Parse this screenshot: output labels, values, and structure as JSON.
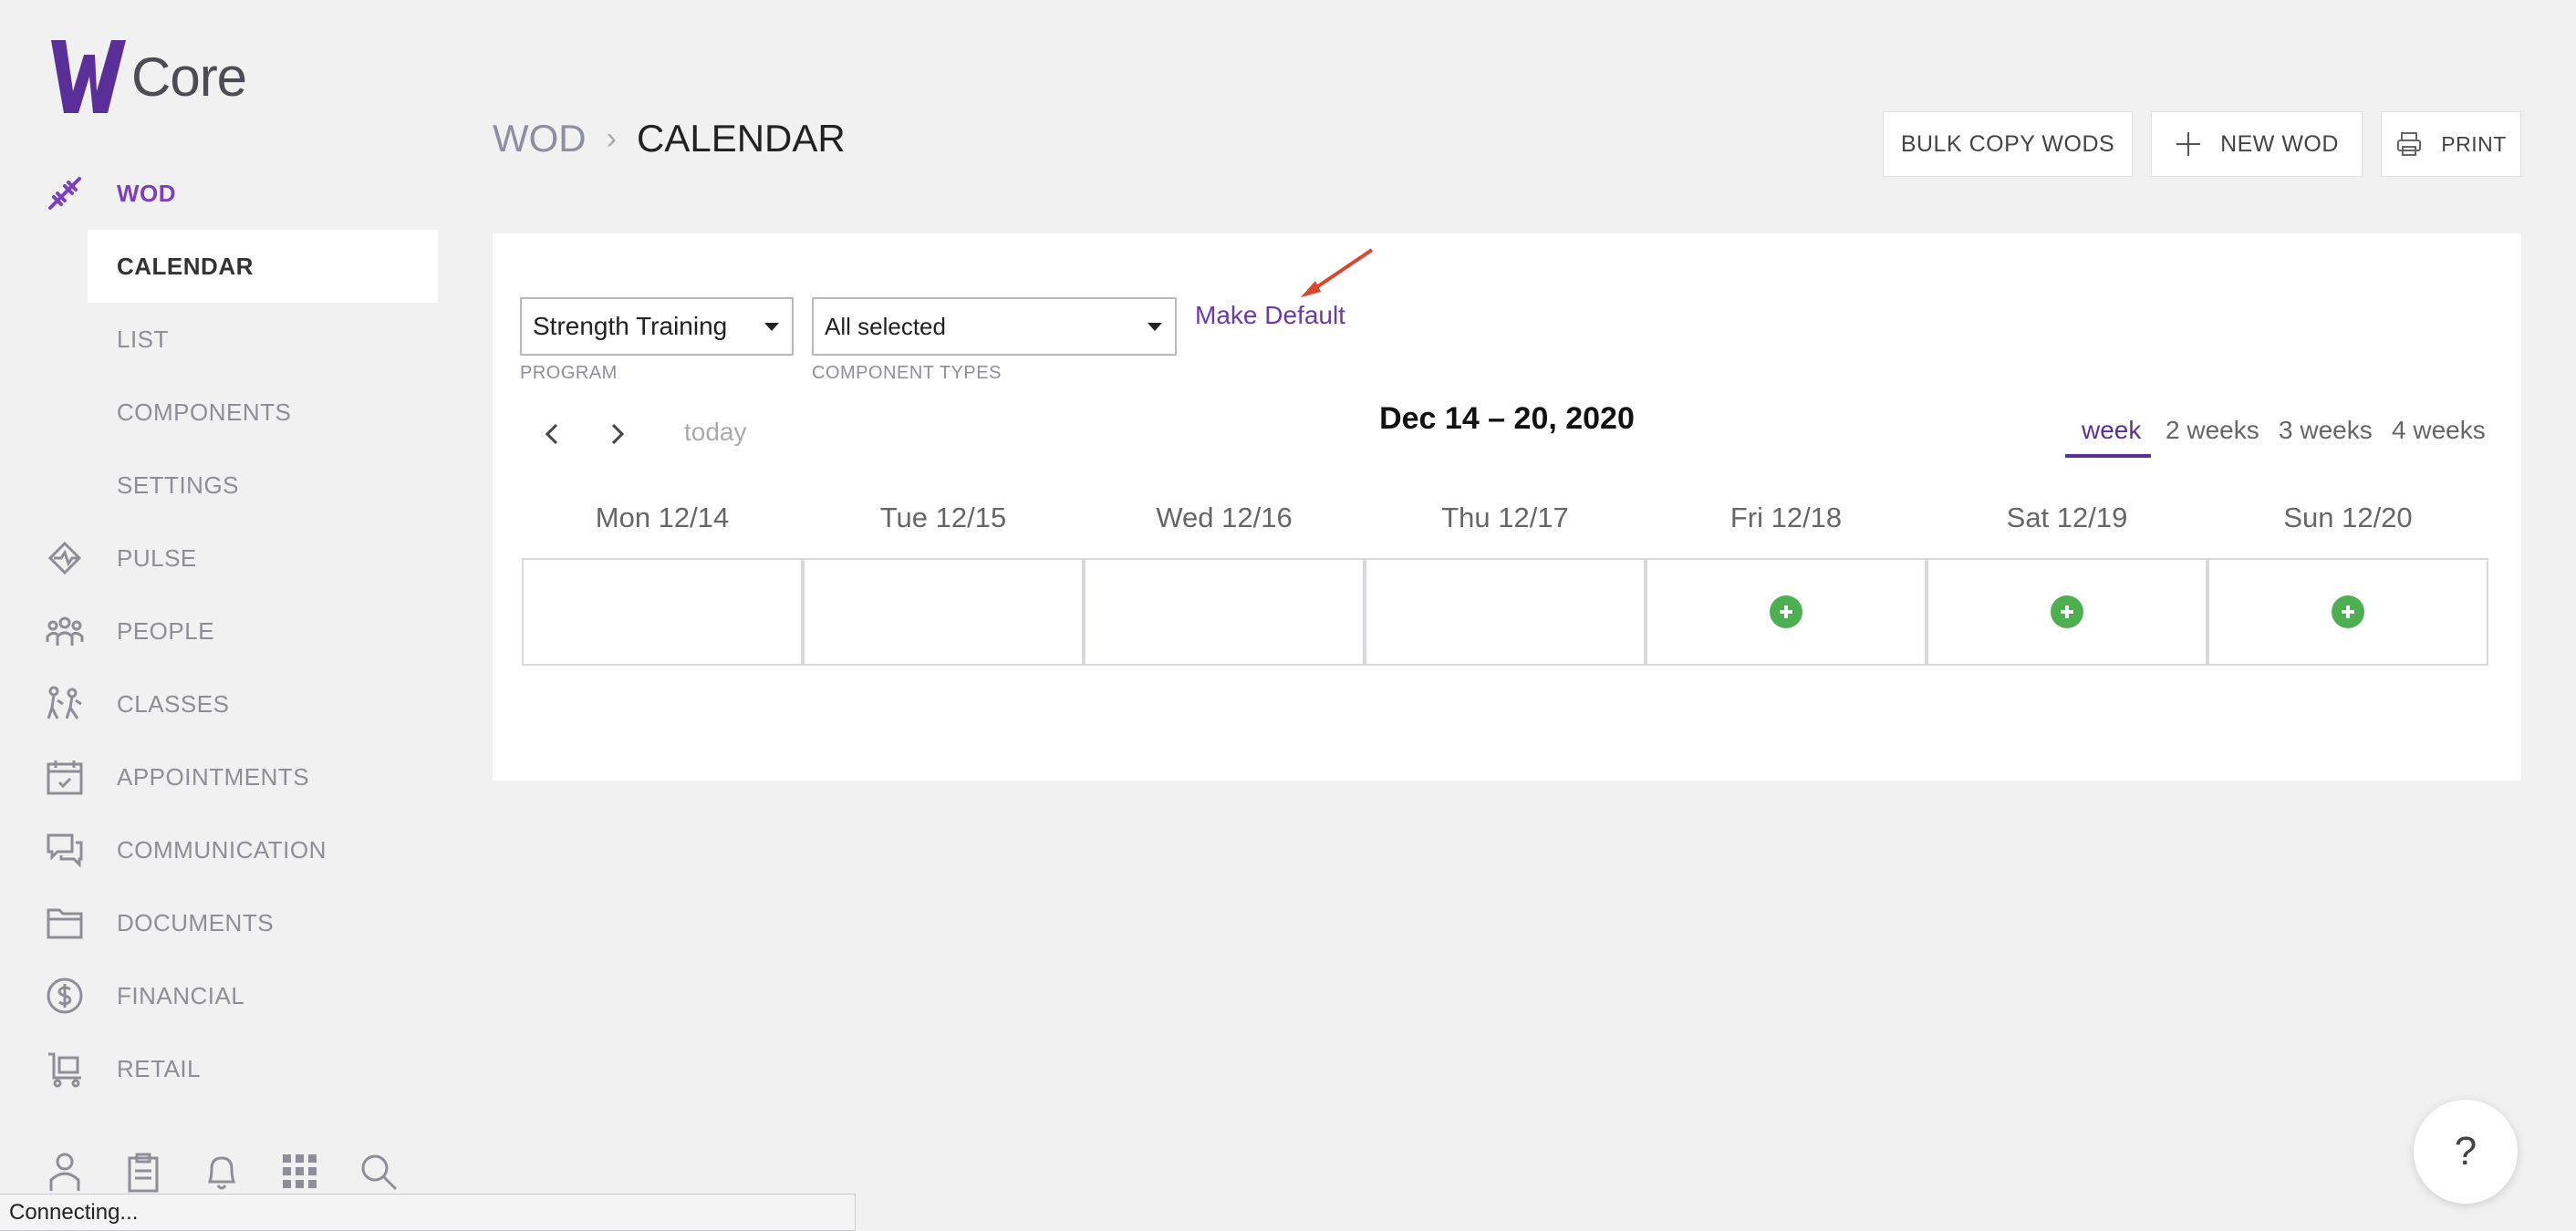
{
  "app": {
    "logo_text": "Core"
  },
  "sidebar": {
    "items": [
      {
        "label": "WOD",
        "icon": "dumbbell-icon"
      },
      {
        "label": "PULSE",
        "icon": "pulse-icon"
      },
      {
        "label": "PEOPLE",
        "icon": "people-icon"
      },
      {
        "label": "CLASSES",
        "icon": "classes-icon"
      },
      {
        "label": "APPOINTMENTS",
        "icon": "calendar-icon"
      },
      {
        "label": "COMMUNICATION",
        "icon": "chat-icon"
      },
      {
        "label": "DOCUMENTS",
        "icon": "folder-icon"
      },
      {
        "label": "FINANCIAL",
        "icon": "dollar-icon"
      },
      {
        "label": "RETAIL",
        "icon": "cart-icon"
      }
    ],
    "sub_items": [
      {
        "label": "CALENDAR"
      },
      {
        "label": "LIST"
      },
      {
        "label": "COMPONENTS"
      },
      {
        "label": "SETTINGS"
      }
    ],
    "bottom_icons": [
      "user-icon",
      "clipboard-icon",
      "bell-icon",
      "grid-icon",
      "search-icon"
    ]
  },
  "header": {
    "breadcrumb_root": "WOD",
    "breadcrumb_sep": "›",
    "breadcrumb_current": "CALENDAR",
    "bulk_copy_label": "BULK COPY WODS",
    "new_wod_label": "NEW WOD",
    "print_label": "PRINT"
  },
  "filters": {
    "program_value": "Strength Training",
    "program_label": "PROGRAM",
    "component_value": "All selected",
    "component_label": "COMPONENT TYPES",
    "make_default": "Make Default"
  },
  "calendar": {
    "today_label": "today",
    "range": "Dec 14 – 20, 2020",
    "views": [
      "week",
      "2 weeks",
      "3 weeks",
      "4 weeks"
    ],
    "active_view": "week",
    "days": [
      "Mon 12/14",
      "Tue 12/15",
      "Wed 12/16",
      "Thu 12/17",
      "Fri 12/18",
      "Sat 12/19",
      "Sun 12/20"
    ],
    "add_enabled": [
      false,
      false,
      false,
      false,
      true,
      true,
      true
    ]
  },
  "status": {
    "text": "Connecting..."
  },
  "help": {
    "label": "?"
  },
  "colors": {
    "accent": "#7b3fbf",
    "add": "#4caf50",
    "link": "#6a3aa8"
  }
}
